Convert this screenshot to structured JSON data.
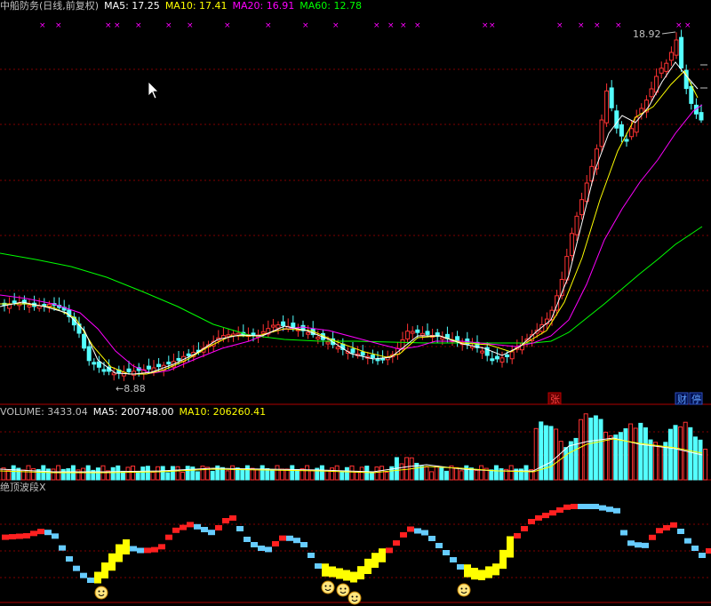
{
  "header": {
    "stock_title": "中船防务(日线,前复权)",
    "ma5": "MA5: 17.25",
    "ma10": "MA10: 17.41",
    "ma20": "MA20: 16.91",
    "ma60": "MA60: 12.78"
  },
  "price_panel": {
    "high_label": "18.92",
    "low_label": "←8.88",
    "badge_zhang": "张",
    "badge_cai": "财",
    "badge_ting": "停"
  },
  "volume_header": {
    "volume": "VOLUME: 3433.04",
    "ma5": "MA5: 200748.00",
    "ma10": "MA10: 206260.41"
  },
  "indicator_header": {
    "name": "绝顶波段X"
  },
  "colors": {
    "background": "#000000",
    "grid": "#800000",
    "up": "#ff3232",
    "down": "#54ffff",
    "ma5": "#ffffff",
    "ma10": "#ffff00",
    "ma20": "#ff00ff",
    "ma60": "#00ff00",
    "marker": "#ff00ff"
  }
}
